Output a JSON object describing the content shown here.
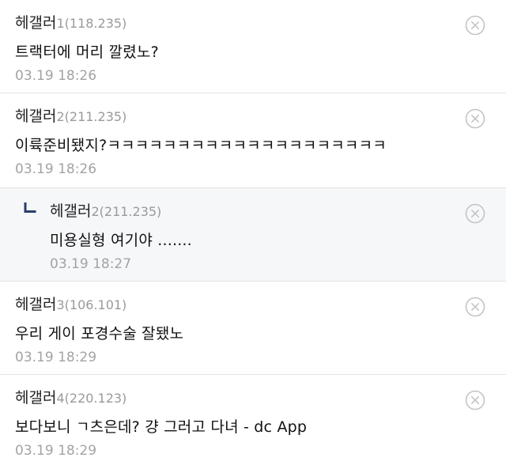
{
  "comments": [
    {
      "nickname": "헤갤러",
      "number": "1",
      "ip": "(118.235)",
      "text": "트랙터에 머리 깔렸노?",
      "time": "03.19 18:26"
    },
    {
      "nickname": "헤갤러",
      "number": "2",
      "ip": "(211.235)",
      "text": "이륙준비됐지?ㅋㅋㅋㅋㅋㅋㅋㅋㅋㅋㅋㅋㅋㅋㅋㅋㅋㅋㅋㅋ",
      "time": "03.19 18:26"
    },
    {
      "nickname": "헤갤러",
      "number": "2",
      "ip": "(211.235)",
      "text": "미용실형 여기야 .......",
      "time": "03.19 18:27",
      "is_reply": true
    },
    {
      "nickname": "헤갤러",
      "number": "3",
      "ip": "(106.101)",
      "text": "우리 게이 포경수술 잘됐노",
      "time": "03.19 18:29"
    },
    {
      "nickname": "헤갤러",
      "number": "4",
      "ip": "(220.123)",
      "text": "보다보니 ㄱ츠은데? 걍 그러고 다녀 - dc App",
      "time": "03.19 18:29"
    }
  ],
  "icons": {
    "delete": "close-circle-icon",
    "reply": "reply-arrow-icon"
  },
  "colors": {
    "reply_background": "#f6f7f9",
    "meta_text": "#9a9a9a",
    "divider": "#e4e4e4"
  }
}
